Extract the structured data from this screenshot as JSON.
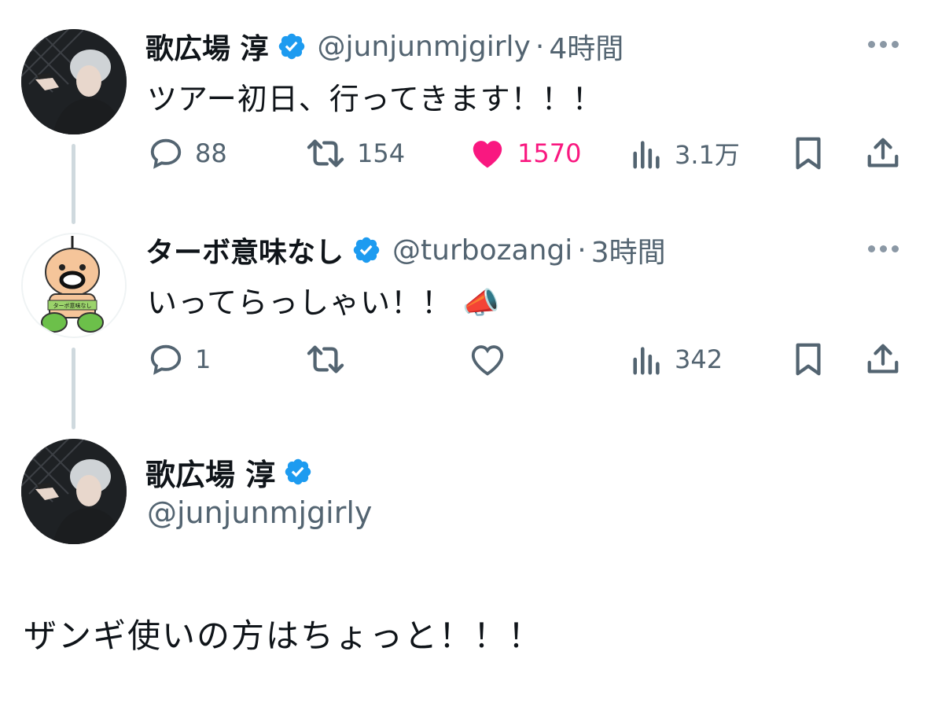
{
  "tweets": [
    {
      "name": "歌広場 淳",
      "handle": "@junjunmjgirly",
      "separator": "·",
      "time": "4時間",
      "text": "ツアー初日、行ってきます！！！",
      "replies": "88",
      "retweets": "154",
      "likes": "1570",
      "views": "3.1万",
      "liked": true
    },
    {
      "name": "ターボ意味なし",
      "handle": "@turbozangi",
      "separator": "·",
      "time": "3時間",
      "text": "いってらっしゃい！！",
      "emoji": "📣",
      "replies": "1",
      "retweets": "",
      "likes": "",
      "views": "342",
      "liked": false
    }
  ],
  "main_post": {
    "name": "歌広場 淳",
    "handle": "@junjunmjgirly",
    "text": "ザンギ使いの方はちょっと！！！"
  },
  "avatar_badge_text": "ターボ意味なし",
  "colors": {
    "verified": "#1d9bf0",
    "like": "#f91880",
    "secondary_text": "#536471",
    "thread_line": "#cfd9de"
  },
  "icons": {
    "reply": "speech-bubble-icon",
    "retweet": "retweet-arrows-icon",
    "like": "heart-icon",
    "views": "bar-chart-icon",
    "bookmark": "bookmark-icon",
    "share": "share-upload-icon",
    "more": "more-dots-icon",
    "verified": "verified-badge-icon"
  }
}
